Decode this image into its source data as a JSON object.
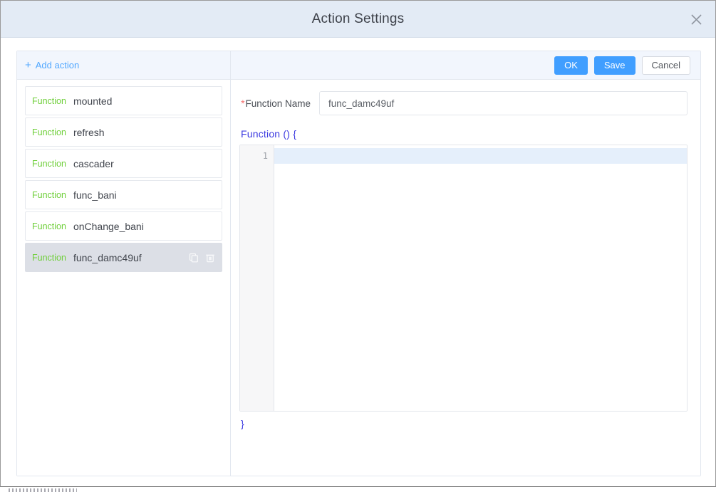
{
  "dialog": {
    "title": "Action Settings",
    "close_icon": "close-icon"
  },
  "left_panel": {
    "add_action_label": "Add action",
    "add_action_plus": "+",
    "functions": [
      {
        "tag": "Function",
        "name": "mounted",
        "selected": false
      },
      {
        "tag": "Function",
        "name": "refresh",
        "selected": false
      },
      {
        "tag": "Function",
        "name": "cascader",
        "selected": false
      },
      {
        "tag": "Function",
        "name": "func_bani",
        "selected": false
      },
      {
        "tag": "Function",
        "name": "onChange_bani",
        "selected": false
      },
      {
        "tag": "Function",
        "name": "func_damc49uf",
        "selected": true
      }
    ],
    "item_actions": {
      "copy_icon": "copy-icon",
      "delete_icon": "trash-icon"
    }
  },
  "right_panel": {
    "buttons": {
      "ok_label": "OK",
      "save_label": "Save",
      "cancel_label": "Cancel"
    },
    "form": {
      "required_marker": "*",
      "function_name_label": "Function Name",
      "function_name_value": "func_damc49uf",
      "function_name_placeholder": ""
    },
    "code": {
      "signature": "Function () {",
      "closing_brace": "}",
      "line_numbers": [
        "1"
      ],
      "lines": [
        ""
      ]
    }
  },
  "colors": {
    "header_bg": "#e3ebf5",
    "toolbar_bg": "#f2f6fd",
    "primary": "#409eff",
    "link": "#53a8ff",
    "tag_green": "#6fcf3a",
    "code_blue": "#3b39e0",
    "selected_bg": "#dcdfe6",
    "required_red": "#f56c6c",
    "active_line_bg": "#e5effb"
  }
}
